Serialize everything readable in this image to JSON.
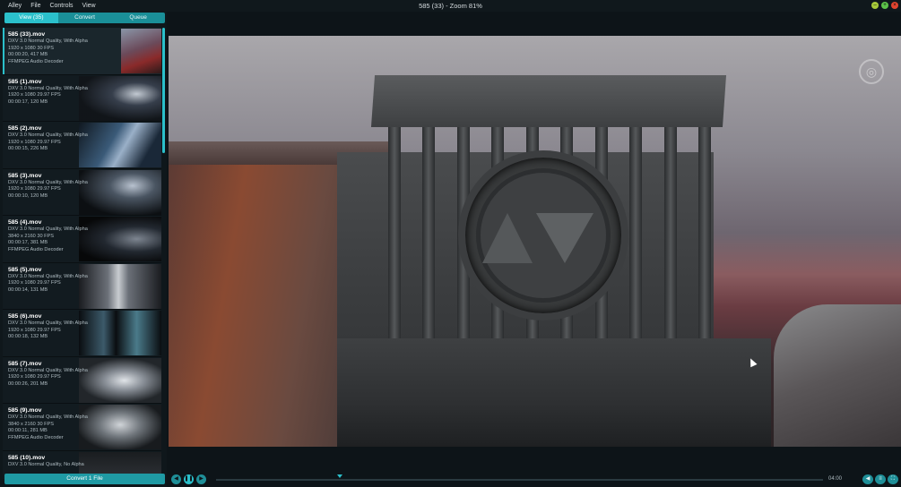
{
  "menu": [
    "Alley",
    "File",
    "Controls",
    "View"
  ],
  "window": {
    "title": "585 (33) - Zoom 81%",
    "buttons": [
      "–",
      "+",
      "×"
    ]
  },
  "tabs": [
    {
      "label": "View (35)",
      "active": true
    },
    {
      "label": "Convert",
      "active": false
    },
    {
      "label": "Queue",
      "active": false
    }
  ],
  "files": [
    {
      "name": "585 (33).mov",
      "codec": "DXV 3.0 Normal Quality, With Alpha",
      "res": "1920 x 1080 30 FPS",
      "meta": "00:00:20, 417 MB",
      "audio": "FFMPEG Audio Decoder",
      "selected": true
    },
    {
      "name": "585 (1).mov",
      "codec": "DXV 3.0 Normal Quality, With Alpha",
      "res": "1920 x 1080 29.97 FPS",
      "meta": "00:00:17, 120 MB",
      "audio": ""
    },
    {
      "name": "585 (2).mov",
      "codec": "DXV 3.0 Normal Quality, With Alpha",
      "res": "1920 x 1080 29.97 FPS",
      "meta": "00:00:15, 226 MB",
      "audio": ""
    },
    {
      "name": "585 (3).mov",
      "codec": "DXV 3.0 Normal Quality, With Alpha",
      "res": "1920 x 1080 29.97 FPS",
      "meta": "00:00:10, 120 MB",
      "audio": ""
    },
    {
      "name": "585 (4).mov",
      "codec": "DXV 3.0 Normal Quality, With Alpha",
      "res": "3840 x 2160 30 FPS",
      "meta": "00:00:17, 381 MB",
      "audio": "FFMPEG Audio Decoder"
    },
    {
      "name": "585 (5).mov",
      "codec": "DXV 3.0 Normal Quality, With Alpha",
      "res": "1920 x 1080 29.97 FPS",
      "meta": "00:00:14, 131 MB",
      "audio": ""
    },
    {
      "name": "585 (6).mov",
      "codec": "DXV 3.0 Normal Quality, With Alpha",
      "res": "1920 x 1080 29.97 FPS",
      "meta": "00:00:18, 132 MB",
      "audio": ""
    },
    {
      "name": "585 (7).mov",
      "codec": "DXV 3.0 Normal Quality, With Alpha",
      "res": "1920 x 1080 29.97 FPS",
      "meta": "00:00:26, 201 MB",
      "audio": ""
    },
    {
      "name": "585 (9).mov",
      "codec": "DXV 3.0 Normal Quality, With Alpha",
      "res": "3840 x 2160 30 FPS",
      "meta": "00:00:11, 281 MB",
      "audio": "FFMPEG Audio Decoder"
    },
    {
      "name": "585 (10).mov",
      "codec": "DXV 3.0 Normal Quality, No Alpha",
      "res": "",
      "meta": "",
      "audio": ""
    }
  ],
  "convert_button": "Convert 1 File",
  "playback": {
    "timecode": "04:00",
    "progress": 0.0
  },
  "colors": {
    "accent": "#2bc0cb",
    "accent_dark": "#1f8f98",
    "panel": "#0f171b",
    "background": "#0d1418"
  },
  "icons": {
    "prev": "skip-back-icon",
    "pause": "pause-icon",
    "next": "skip-forward-icon",
    "volume": "speaker-icon",
    "list": "list-icon",
    "fullscreen": "fullscreen-icon"
  }
}
